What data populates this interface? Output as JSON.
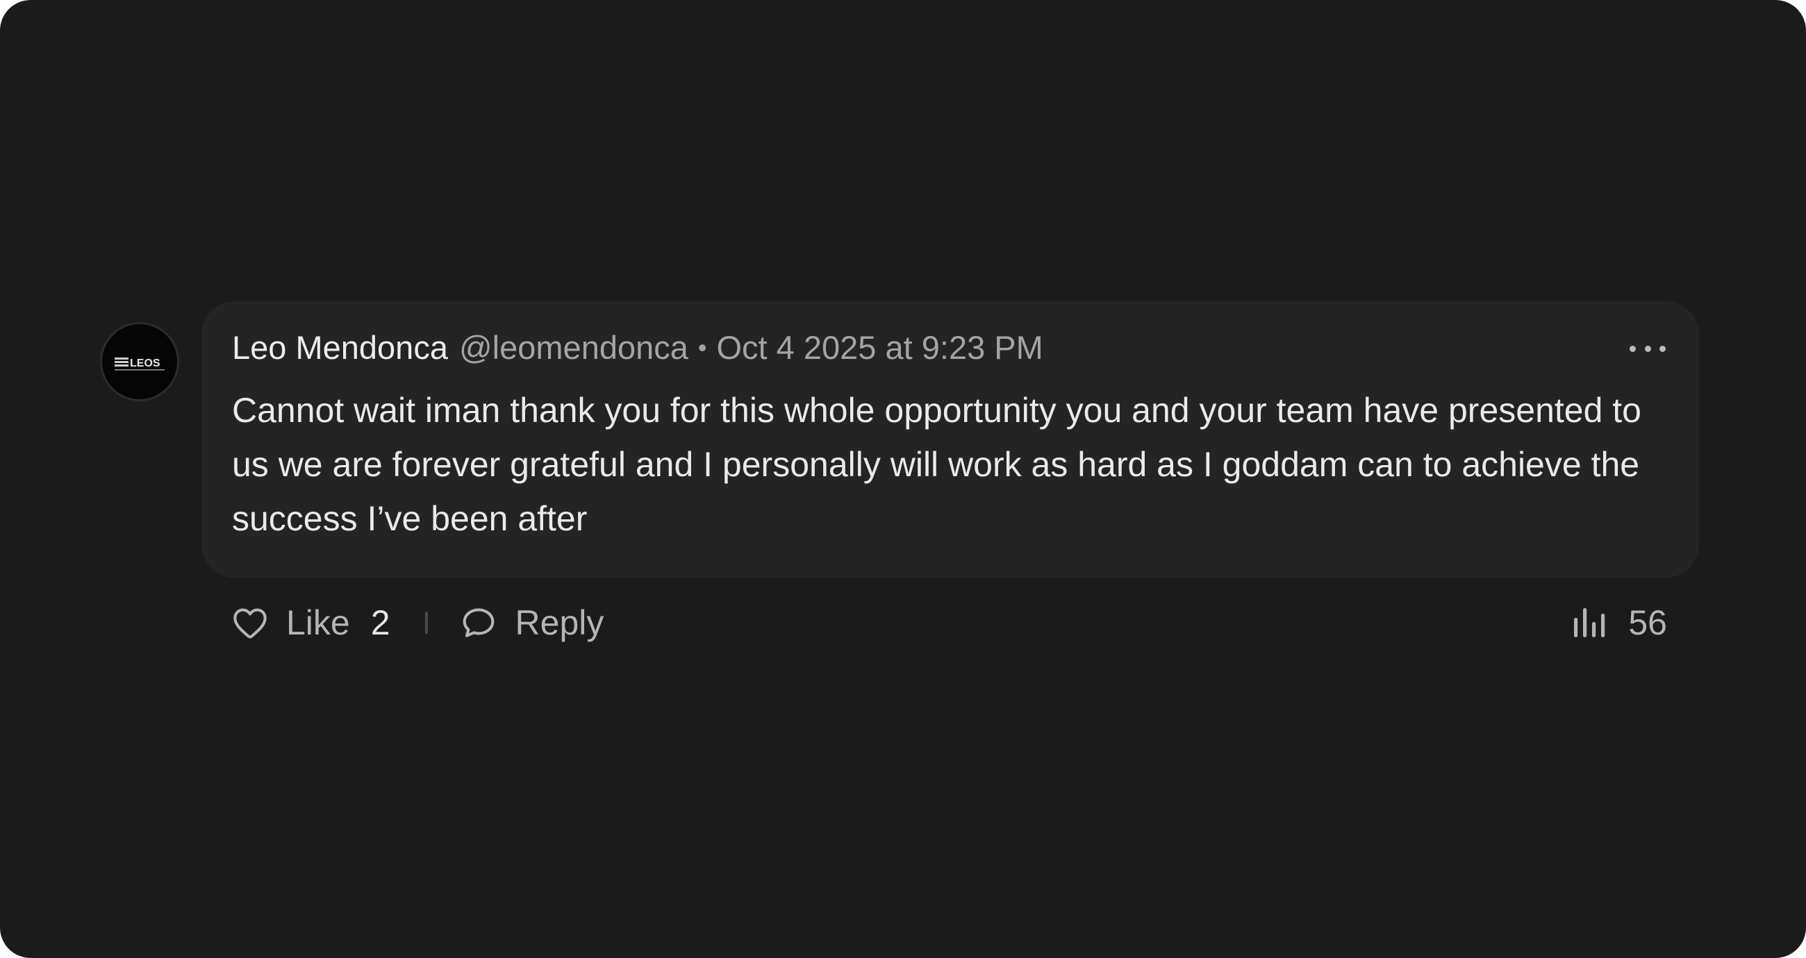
{
  "comment": {
    "avatar": {
      "icon": "leos-logo-avatar",
      "logo_text": "LEOS"
    },
    "author_name": "Leo Mendonca",
    "handle": "@leomendonca",
    "separator": "•",
    "timestamp": "Oct 4 2025 at 9:23 PM",
    "more_icon": "more-horizontal-icon",
    "body": "Cannot wait iman thank you for this whole opportunity you and your team have presented to us we are forever grateful and I personally will work as hard as I goddam can to achieve the success I’ve been after"
  },
  "actions": {
    "like_icon": "heart-outline-icon",
    "like_label": "Like",
    "like_count": "2",
    "reply_icon": "speech-bubble-icon",
    "reply_label": "Reply",
    "views_icon": "bar-chart-icon",
    "views_count": "56"
  },
  "colors": {
    "background": "#1b1b1b",
    "bubble": "#242424",
    "primary_text": "#eaeaea",
    "secondary_text": "#a4a4a4"
  }
}
